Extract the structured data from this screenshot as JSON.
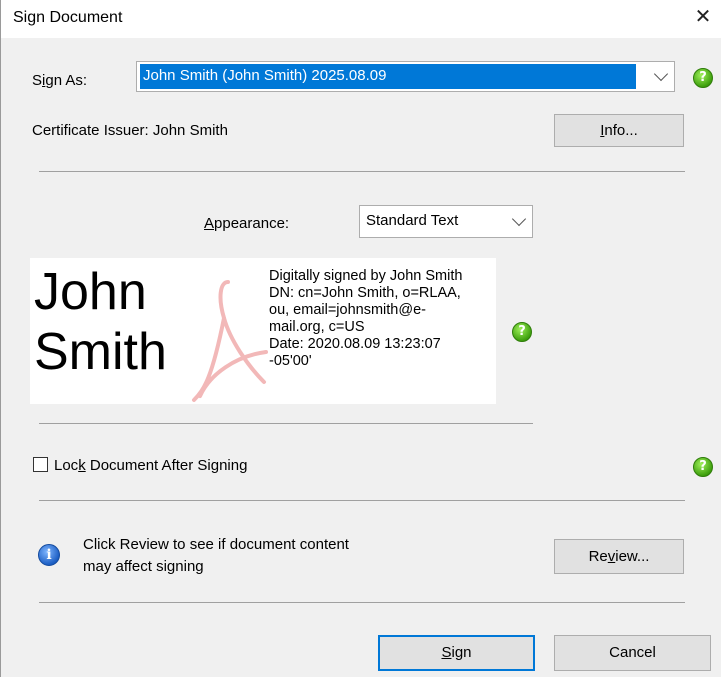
{
  "window": {
    "title": "Sign Document"
  },
  "sign_as": {
    "label_pre": "S",
    "label_accel": "i",
    "label_post": "gn As:",
    "selected": "John Smith (John Smith) 2025.08.09"
  },
  "certificate": {
    "issuer_text": "Certificate Issuer: John Smith"
  },
  "info_button": {
    "accel": "I",
    "rest": "nfo..."
  },
  "appearance": {
    "label_accel": "A",
    "label_rest": "ppearance:",
    "selected": "Standard Text"
  },
  "preview": {
    "name_line1": "John",
    "name_line2": "Smith",
    "details": [
      "Digitally signed by John Smith",
      "DN: cn=John Smith, o=RLAA,",
      "ou, email=johnsmith@e-",
      "mail.org, c=US",
      "Date: 2020.08.09 13:23:07",
      "-05'00'"
    ]
  },
  "lock": {
    "label_pre": "Loc",
    "label_accel": "k",
    "label_post": " Document After Signing",
    "checked": false
  },
  "review": {
    "message_line1": "Click Review to see if document content",
    "message_line2": "may affect signing",
    "button_pre": "Re",
    "button_accel": "v",
    "button_post": "iew..."
  },
  "footer": {
    "sign_accel": "S",
    "sign_rest": "ign",
    "cancel_label": "Cancel"
  },
  "icons": {
    "help": "question-help-icon",
    "info": "info-icon",
    "close": "close-icon",
    "dropdown": "chevron-down-icon"
  },
  "colors": {
    "accent": "#0078d7",
    "help_green": "#3fa00e",
    "info_blue": "#1d5fc4",
    "pdf_mark": "#f2b8b8"
  }
}
